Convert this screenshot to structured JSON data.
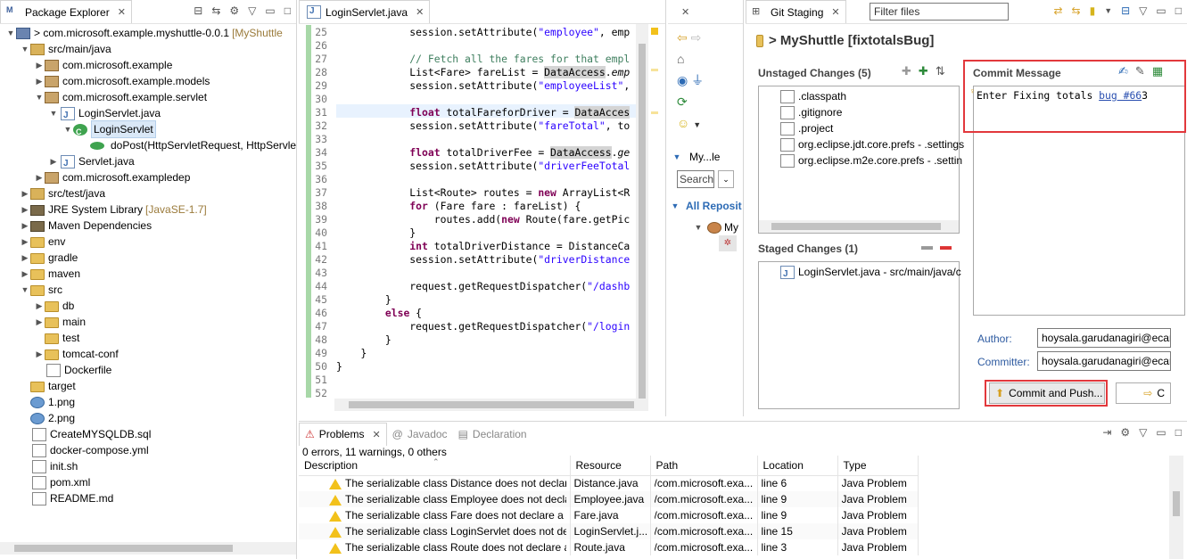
{
  "package_explorer": {
    "tab_label": "Package Explorer",
    "tree": [
      {
        "label": "> com.microsoft.example.myshuttle-0.0.1",
        "decor": "[MyShuttle",
        "icon": "proj",
        "toggle": "▼",
        "indent": 0
      },
      {
        "label": "src/main/java",
        "decor": "",
        "icon": "pkgfolder",
        "toggle": "▼",
        "indent": 1
      },
      {
        "label": "com.microsoft.example",
        "decor": "",
        "icon": "pkg",
        "toggle": "▶",
        "indent": 2
      },
      {
        "label": "com.microsoft.example.models",
        "decor": "",
        "icon": "pkg",
        "toggle": "▶",
        "indent": 2
      },
      {
        "label": "com.microsoft.example.servlet",
        "decor": "",
        "icon": "pkg",
        "toggle": "▼",
        "indent": 2
      },
      {
        "label": "LoginServlet.java",
        "decor": "",
        "icon": "java",
        "toggle": "▼",
        "indent": 3
      },
      {
        "label": "LoginServlet",
        "decor": "",
        "icon": "cls",
        "toggle": "▼",
        "indent": 4,
        "selected": true
      },
      {
        "label": "doPost(HttpServletRequest, HttpServlet",
        "decor": "",
        "icon": "method",
        "toggle": "",
        "indent": 5
      },
      {
        "label": "Servlet.java",
        "decor": "",
        "icon": "java",
        "toggle": "▶",
        "indent": 3
      },
      {
        "label": "com.microsoft.exampledep",
        "decor": "",
        "icon": "pkg",
        "toggle": "▶",
        "indent": 2
      },
      {
        "label": "src/test/java",
        "decor": "",
        "icon": "pkgfolder",
        "toggle": "▶",
        "indent": 1
      },
      {
        "label": "JRE System Library",
        "decor": "[JavaSE-1.7]",
        "icon": "lib",
        "toggle": "▶",
        "indent": 1
      },
      {
        "label": "Maven Dependencies",
        "decor": "",
        "icon": "lib",
        "toggle": "▶",
        "indent": 1
      },
      {
        "label": "env",
        "decor": "",
        "icon": "folder",
        "toggle": "▶",
        "indent": 1
      },
      {
        "label": "gradle",
        "decor": "",
        "icon": "folder",
        "toggle": "▶",
        "indent": 1
      },
      {
        "label": "maven",
        "decor": "",
        "icon": "folder",
        "toggle": "▶",
        "indent": 1
      },
      {
        "label": "src",
        "decor": "",
        "icon": "folder",
        "toggle": "▼",
        "indent": 1
      },
      {
        "label": "db",
        "decor": "",
        "icon": "folder",
        "toggle": "▶",
        "indent": 2
      },
      {
        "label": "main",
        "decor": "",
        "icon": "folder",
        "toggle": "▶",
        "indent": 2
      },
      {
        "label": "test",
        "decor": "",
        "icon": "folder",
        "toggle": "",
        "indent": 2
      },
      {
        "label": "tomcat-conf",
        "decor": "",
        "icon": "folder",
        "toggle": "▶",
        "indent": 2
      },
      {
        "label": "Dockerfile",
        "decor": "",
        "icon": "file",
        "toggle": "",
        "indent": 2
      },
      {
        "label": "target",
        "decor": "",
        "icon": "folder",
        "toggle": "",
        "indent": 1
      },
      {
        "label": "1.png",
        "decor": "",
        "icon": "img",
        "toggle": "",
        "indent": 1
      },
      {
        "label": "2.png",
        "decor": "",
        "icon": "img",
        "toggle": "",
        "indent": 1
      },
      {
        "label": "CreateMYSQLDB.sql",
        "decor": "",
        "icon": "file",
        "toggle": "",
        "indent": 1
      },
      {
        "label": "docker-compose.yml",
        "decor": "",
        "icon": "file",
        "toggle": "",
        "indent": 1
      },
      {
        "label": "init.sh",
        "decor": "",
        "icon": "file",
        "toggle": "",
        "indent": 1
      },
      {
        "label": "pom.xml",
        "decor": "",
        "icon": "file",
        "toggle": "",
        "indent": 1
      },
      {
        "label": "README.md",
        "decor": "",
        "icon": "file",
        "toggle": "",
        "indent": 1
      }
    ]
  },
  "editor": {
    "tab_label": "LoginServlet.java",
    "lines": [
      {
        "n": "25",
        "html": "            session.setAttribute(<span class='str'>\"employee\"</span>, emp"
      },
      {
        "n": "26",
        "html": ""
      },
      {
        "n": "27",
        "html": "            <span class='cm'>// Fetch all the fares for that empl</span>"
      },
      {
        "n": "28",
        "html": "            List&lt;Fare&gt; fareList = <span class='hl'>DataAccess</span>.<span class='it'>emp</span>"
      },
      {
        "n": "29",
        "html": "            session.setAttribute(<span class='str'>\"employeeList\"</span>,"
      },
      {
        "n": "30",
        "html": ""
      },
      {
        "n": "31",
        "html": "            <span class='kw'>float</span> totalFareforDriver = <span class='hl'>DataAcces</span>"
      },
      {
        "n": "32",
        "html": "            session.setAttribute(<span class='str'>\"fareTotal\"</span>, to"
      },
      {
        "n": "33",
        "html": ""
      },
      {
        "n": "34",
        "html": "            <span class='kw'>float</span> totalDriverFee = <span class='hl'>DataAccess</span>.<span class='it'>ge</span>"
      },
      {
        "n": "35",
        "html": "            session.setAttribute(<span class='str'>\"driverFeeTotal</span>"
      },
      {
        "n": "36",
        "html": ""
      },
      {
        "n": "37",
        "html": "            List&lt;Route&gt; routes = <span class='kw'>new</span> ArrayList&lt;R"
      },
      {
        "n": "38",
        "html": "            <span class='kw'>for</span> (Fare fare : fareList) {"
      },
      {
        "n": "39",
        "html": "                routes.add(<span class='kw'>new</span> Route(fare.getPic"
      },
      {
        "n": "40",
        "html": "            }"
      },
      {
        "n": "41",
        "html": "            <span class='kw'>int</span> totalDriverDistance = DistanceCa"
      },
      {
        "n": "42",
        "html": "            session.setAttribute(<span class='str'>\"driverDistance</span>"
      },
      {
        "n": "43",
        "html": ""
      },
      {
        "n": "44",
        "html": "            request.getRequestDispatcher(<span class='str'>\"/dashb</span>"
      },
      {
        "n": "45",
        "html": "        }"
      },
      {
        "n": "46",
        "html": "        <span class='kw'>else</span> {"
      },
      {
        "n": "47",
        "html": "            request.getRequestDispatcher(<span class='str'>\"/login</span>"
      },
      {
        "n": "48",
        "html": "        }"
      },
      {
        "n": "49",
        "html": "    }"
      },
      {
        "n": "50",
        "html": "}"
      },
      {
        "n": "51",
        "html": ""
      },
      {
        "n": "52",
        "html": ""
      }
    ]
  },
  "repos": {
    "tab_label": "",
    "node_label": "My...le",
    "search_placeholder": "Search",
    "all_repos_label": "All Reposit",
    "child_label": "My"
  },
  "git_staging": {
    "tab_label": "Git Staging",
    "filter_placeholder": "Filter files",
    "repo_title": "> MyShuttle [fixtotalsBug]",
    "unstaged_title": "Unstaged Changes (5)",
    "unstaged": [
      ".classpath",
      ".gitignore",
      ".project",
      "org.eclipse.jdt.core.prefs - .settings",
      "org.eclipse.m2e.core.prefs - .settin"
    ],
    "staged_title": "Staged Changes (1)",
    "staged": [
      "LoginServlet.java - src/main/java/c"
    ],
    "commit_title": "Commit Message",
    "commit_text_pre": "Enter Fixing totals ",
    "commit_link": "bug #66",
    "commit_text_post": "3",
    "author_label": "Author:",
    "author_value": "hoysala.garudanagiri@ecar",
    "committer_label": "Committer:",
    "committer_value": "hoysala.garudanagiri@ecar",
    "commit_push_label": "Commit and Push...",
    "commit_label": "C"
  },
  "problems": {
    "tab_problems": "Problems",
    "tab_javadoc": "Javadoc",
    "tab_declaration": "Declaration",
    "summary": "0 errors, 11 warnings, 0 others",
    "columns": [
      "Description",
      "Resource",
      "Path",
      "Location",
      "Type"
    ],
    "rows": [
      [
        "The serializable class Distance does not declare",
        "Distance.java",
        "/com.microsoft.exa...",
        "line 6",
        "Java Problem"
      ],
      [
        "The serializable class Employee does not decla",
        "Employee.java",
        "/com.microsoft.exa...",
        "line 9",
        "Java Problem"
      ],
      [
        "The serializable class Fare does not declare a st",
        "Fare.java",
        "/com.microsoft.exa...",
        "line 9",
        "Java Problem"
      ],
      [
        "The serializable class LoginServlet does not dec",
        "LoginServlet.j...",
        "/com.microsoft.exa...",
        "line 15",
        "Java Problem"
      ],
      [
        "The serializable class Route does not declare a",
        "Route.java",
        "/com.microsoft.exa...",
        "line 3",
        "Java Problem"
      ]
    ]
  }
}
